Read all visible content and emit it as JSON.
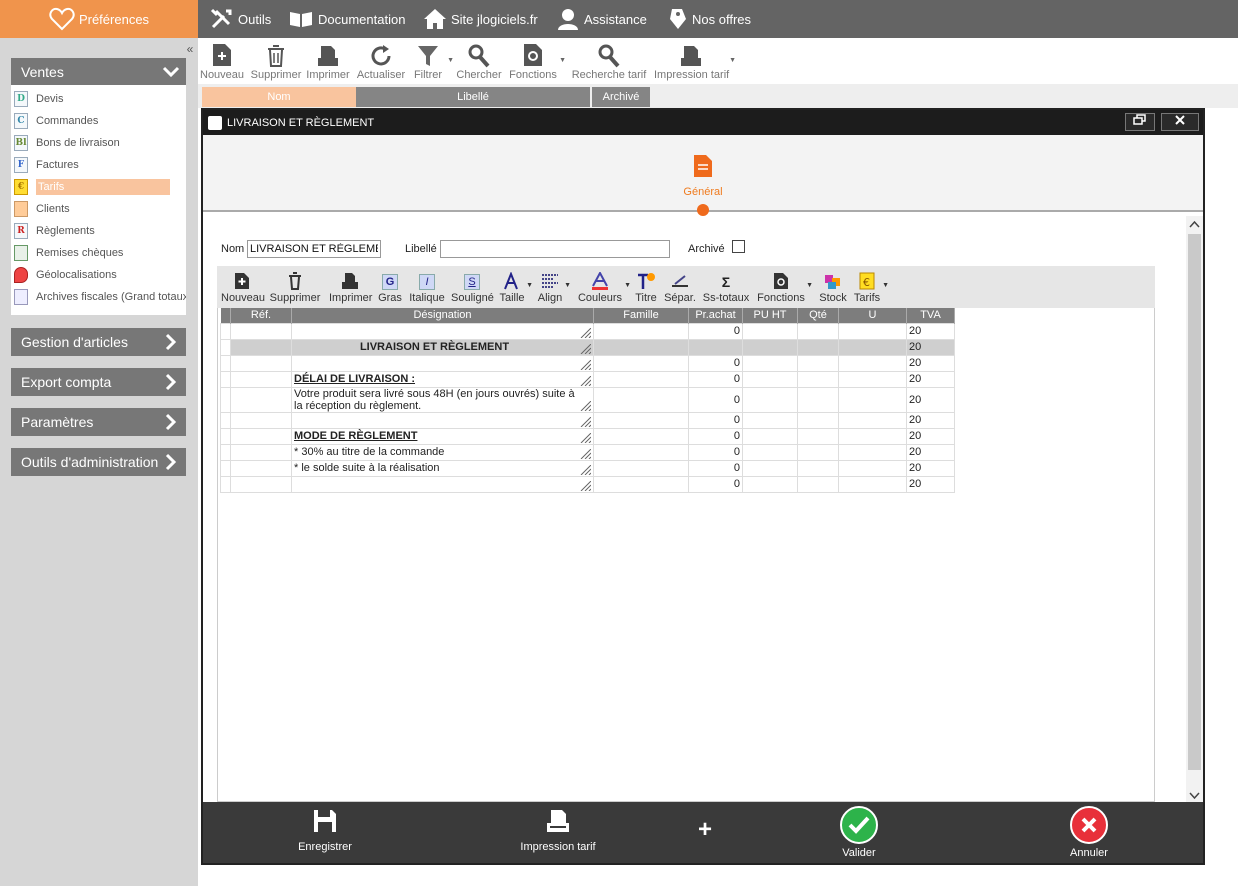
{
  "topbar": {
    "preferences": "Préférences",
    "nav": [
      "Outils",
      "Documentation",
      "Site jlogiciels.fr",
      "Assistance",
      "Nos offres"
    ]
  },
  "sidebar": {
    "collapse": "«",
    "ventes": "Ventes",
    "items": [
      "Devis",
      "Commandes",
      "Bons de livraison",
      "Factures",
      "Tarifs",
      "Clients",
      "Règlements",
      "Remises chèques",
      "Géolocalisations",
      "Archives fiscales (Grand totaux)"
    ],
    "item_icons": [
      "D",
      "C",
      "Bl",
      "F",
      "€",
      "",
      "R",
      "",
      "",
      ""
    ],
    "sections": [
      "Gestion d'articles",
      "Export compta",
      "Paramètres",
      "Outils d'administration"
    ]
  },
  "toolbar": {
    "items": [
      "Nouveau",
      "Supprimer",
      "Imprimer",
      "Actualiser",
      "Filtrer",
      "Chercher",
      "Fonctions",
      "Recherche tarif",
      "Impression tarif"
    ]
  },
  "columns": [
    "Nom",
    "Libellé",
    "Archivé"
  ],
  "dialog": {
    "title": "LIVRAISON ET RÈGLEMENT",
    "tab": "Général",
    "form": {
      "nom_label": "Nom",
      "nom_value": "LIVRAISON ET RÈGLEMENT",
      "libelle_label": "Libellé",
      "libelle_value": "",
      "archive_label": "Archivé"
    },
    "inner_toolbar": [
      "Nouveau",
      "Supprimer",
      "Imprimer",
      "Gras",
      "Italique",
      "Souligné",
      "Taille",
      "Align",
      "Couleurs",
      "Titre",
      "Sépar.",
      "Ss-totaux",
      "Fonctions",
      "Stock",
      "Tarifs"
    ],
    "inner_icons": {
      "gras": "G",
      "italique": "I",
      "souligne": "S",
      "sstotaux": "Σ"
    },
    "grid": {
      "headers": [
        "Réf.",
        "Désignation",
        "Famille",
        "Pr.achat",
        "PU HT",
        "Qté",
        "U",
        "TVA"
      ],
      "rows": [
        {
          "ref": "",
          "designation": "",
          "style": "",
          "prachat": "0",
          "tva": "20"
        },
        {
          "ref": "",
          "designation": "LIVRAISON ET RÈGLEMENT",
          "style": "title",
          "prachat": "",
          "tva": "20"
        },
        {
          "ref": "",
          "designation": "",
          "style": "",
          "prachat": "0",
          "tva": "20"
        },
        {
          "ref": "",
          "designation": "DÉLAI DE LIVRAISON :",
          "style": "heading",
          "prachat": "0",
          "tva": "20"
        },
        {
          "ref": "",
          "designation": "Votre produit sera livré sous 48H (en jours ouvrés) suite à la réception du règlement.",
          "style": "",
          "prachat": "0",
          "tva": "20"
        },
        {
          "ref": "",
          "designation": "",
          "style": "",
          "prachat": "0",
          "tva": "20"
        },
        {
          "ref": "",
          "designation": "MODE DE RÈGLEMENT",
          "style": "heading",
          "prachat": "0",
          "tva": "20"
        },
        {
          "ref": "",
          "designation": "* 30% au titre de la commande",
          "style": "",
          "prachat": "0",
          "tva": "20"
        },
        {
          "ref": "",
          "designation": "* le solde suite à la réalisation",
          "style": "",
          "prachat": "0",
          "tva": "20"
        },
        {
          "ref": "",
          "designation": "",
          "style": "",
          "prachat": "0",
          "tva": "20"
        }
      ]
    },
    "actions": {
      "save": "Enregistrer",
      "print": "Impression tarif",
      "plus": "+",
      "validate": "Valider",
      "cancel": "Annuler"
    }
  },
  "colors": {
    "accent": "#f0944c",
    "dark_bar": "#646464",
    "validate": "#2db34a",
    "cancel": "#e8303a",
    "tab_orange": "#ef6a1c"
  }
}
